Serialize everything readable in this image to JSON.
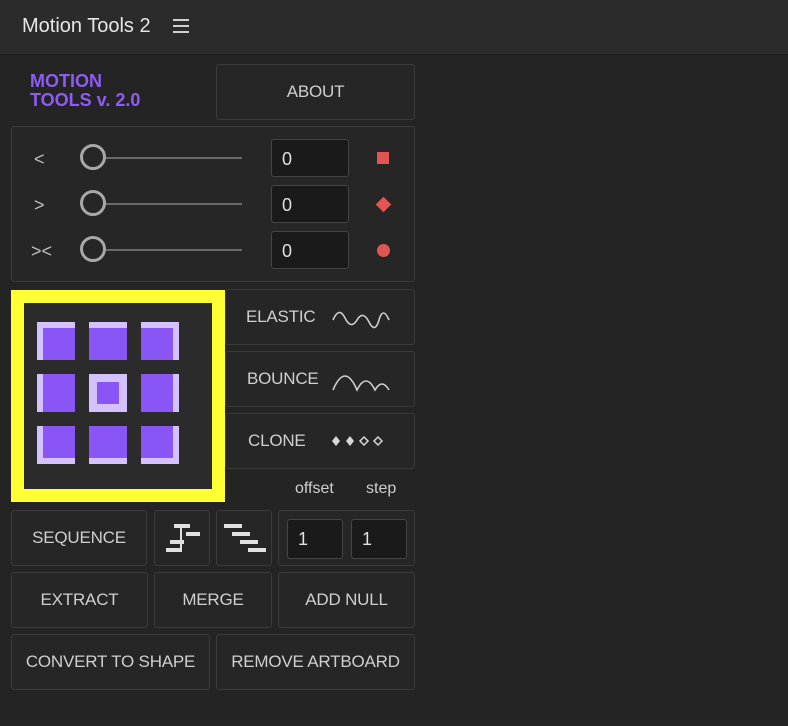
{
  "panel": {
    "title": "Motion Tools 2",
    "menu_icon": "hamburger-menu-icon"
  },
  "logo": {
    "line1": "MOTION",
    "line2": "TOOLS v. 2.0",
    "color": "#8f5bf5"
  },
  "about_label": "ABOUT",
  "sliders": [
    {
      "arrow": "<",
      "value": "0",
      "marker": "square-icon"
    },
    {
      "arrow": ">",
      "value": "0",
      "marker": "diamond-icon"
    },
    {
      "arrow": "><",
      "value": "0",
      "marker": "circle-icon"
    }
  ],
  "buttons": {
    "elastic": "ELASTIC",
    "bounce": "BOUNCE",
    "clone": "CLONE",
    "sequence": "SEQUENCE",
    "extract": "EXTRACT",
    "merge": "MERGE",
    "add_null": "ADD NULL",
    "convert_to_shape": "CONVERT TO SHAPE",
    "remove_artboard": "REMOVE ARTBOARD"
  },
  "sequence": {
    "offset_label": "offset",
    "step_label": "step",
    "offset_value": "1",
    "step_value": "1"
  },
  "colors": {
    "accent": "#8a55f5",
    "highlight": "#ffff33",
    "marker": "#e25555"
  }
}
